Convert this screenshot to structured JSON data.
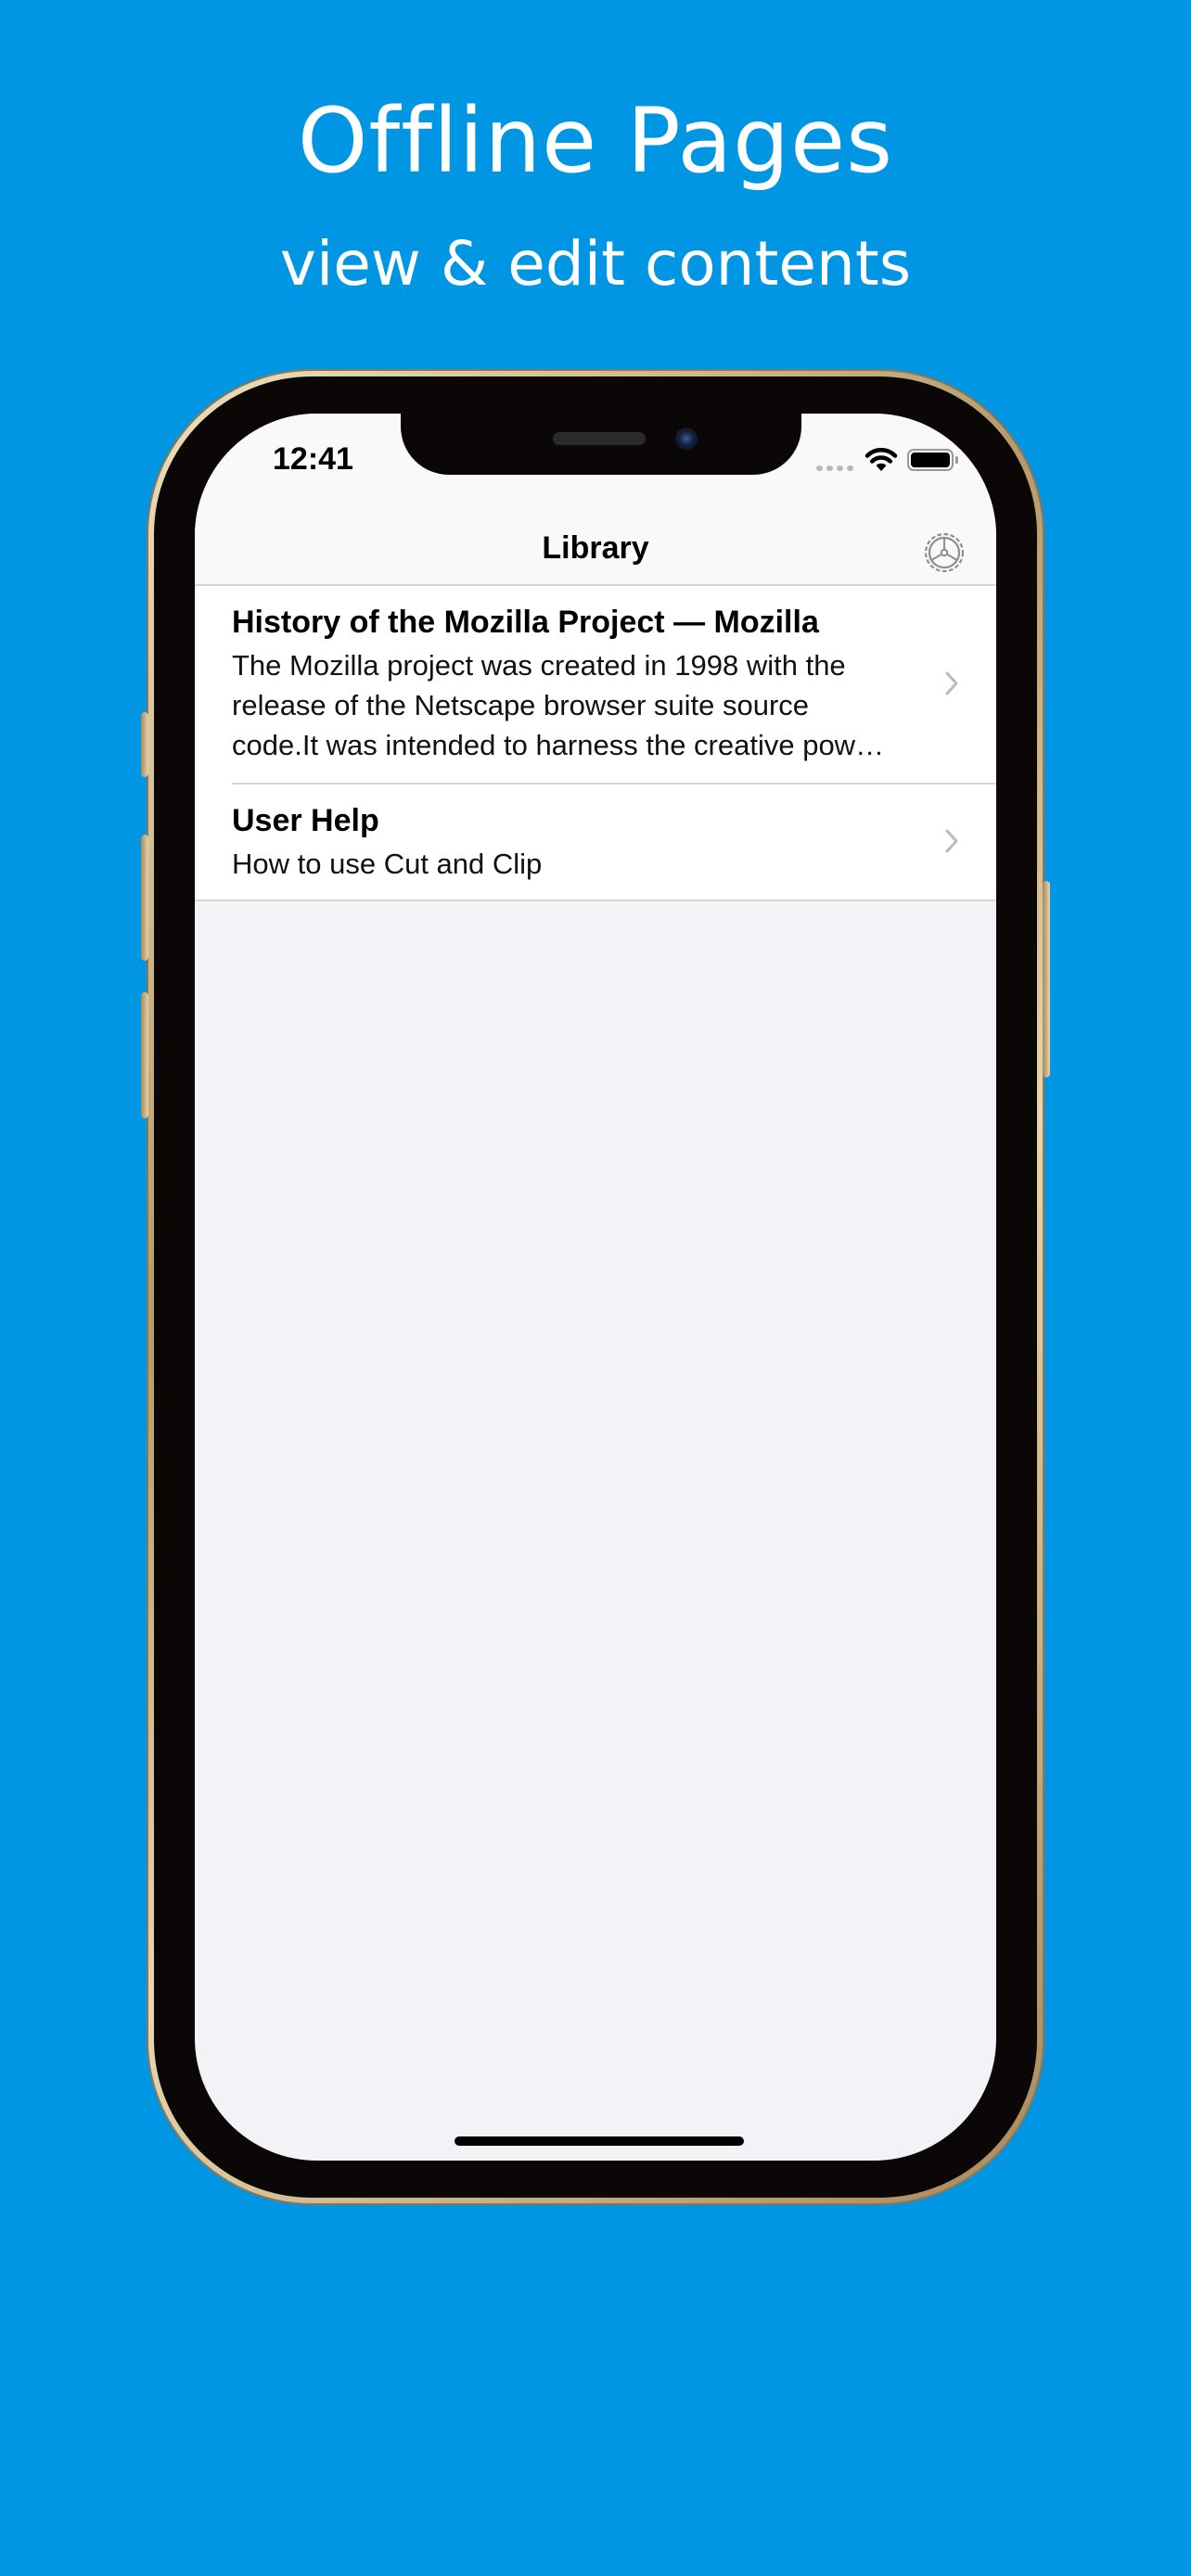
{
  "promo": {
    "title": "Offline Pages",
    "subtitle": "view & edit contents"
  },
  "status_bar": {
    "time": "12:41",
    "icons": [
      "cellular-signal-icon",
      "wifi-icon",
      "battery-icon"
    ]
  },
  "nav": {
    "title": "Library",
    "settings_icon": "gear-icon"
  },
  "library": {
    "items": [
      {
        "title": "History of the Mozilla Project — Mozilla",
        "lines": [
          "The Mozilla project was created in 1998 with the",
          "release of the Netscape browser suite source",
          "code.It was intended to harness the creative pow…"
        ],
        "accessory": "chevron-right-icon"
      },
      {
        "title": "User Help",
        "lines": [
          "How to use Cut and Clip"
        ],
        "accessory": "chevron-right-icon"
      }
    ]
  },
  "colors": {
    "background": "#0096E3",
    "screen_background": "#F2F2F7",
    "bar_background": "#F9F9FB",
    "separator": "#D6D6DA",
    "chevron": "#B9B9BE"
  }
}
